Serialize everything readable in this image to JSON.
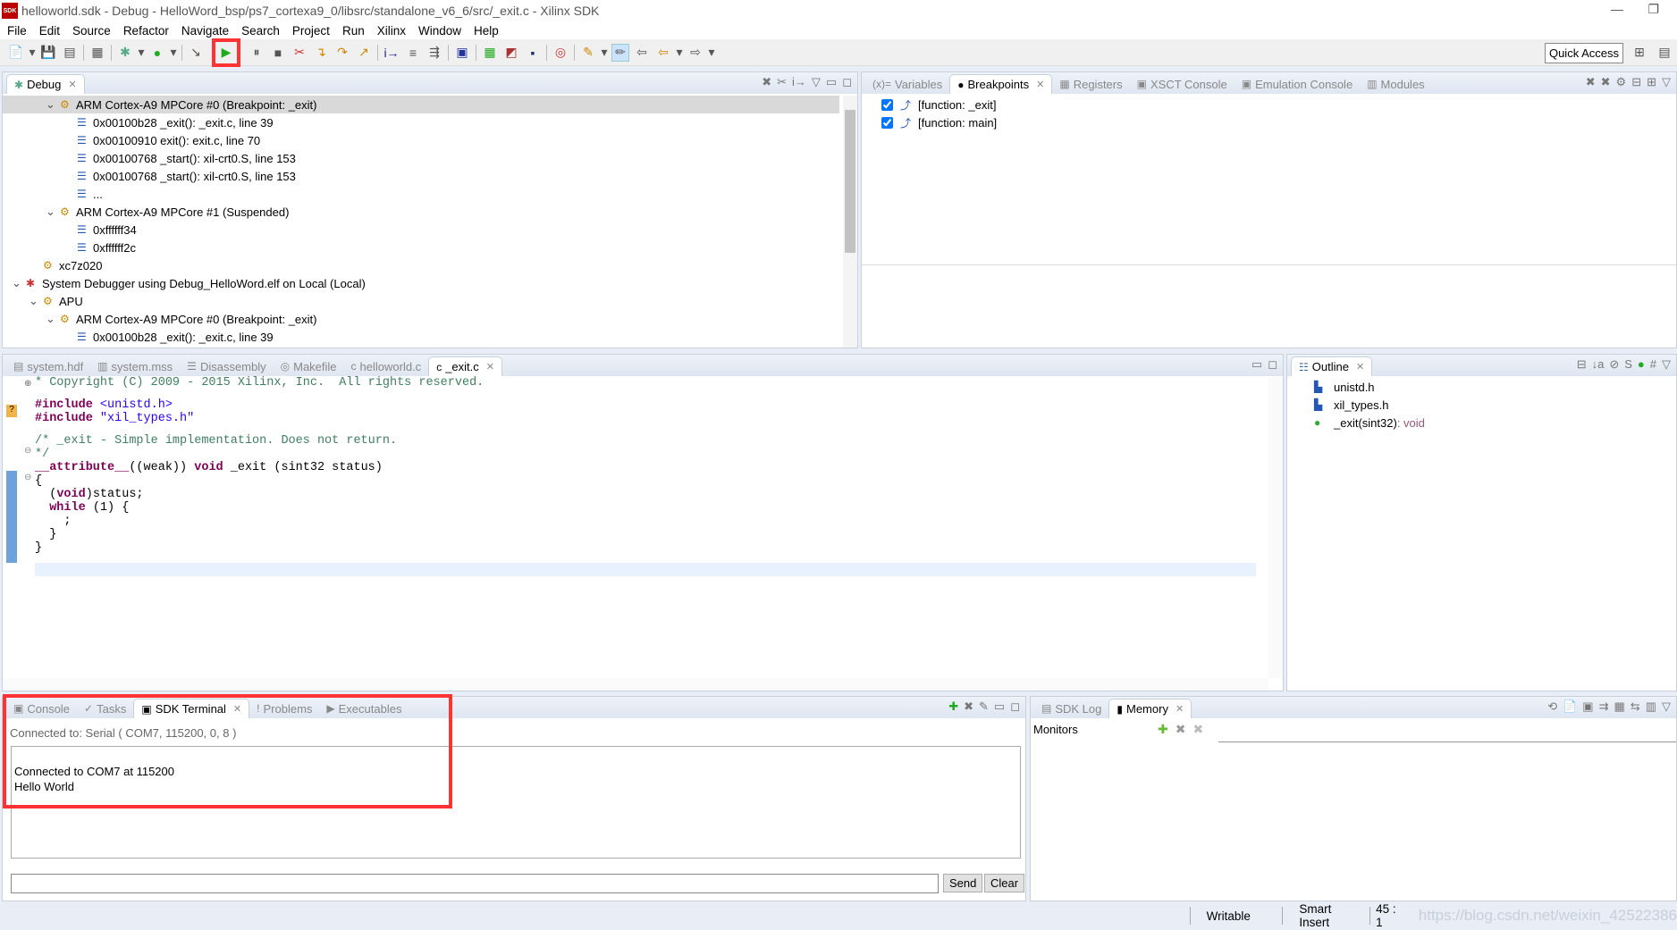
{
  "window": {
    "title": "helloworld.sdk - Debug - HelloWord_bsp/ps7_cortexa9_0/libsrc/standalone_v6_6/src/_exit.c - Xilinx SDK",
    "logo": "SDK"
  },
  "menu": [
    "File",
    "Edit",
    "Source",
    "Refactor",
    "Navigate",
    "Search",
    "Project",
    "Run",
    "Xilinx",
    "Window",
    "Help"
  ],
  "toolbar": {
    "quick_access": "Quick Access",
    "highlighted": "resume-button",
    "highlight_color": "#f33333"
  },
  "debug": {
    "tab": "Debug",
    "tree": [
      {
        "level": 2,
        "icon": "thread",
        "text": "ARM Cortex-A9 MPCore #0 (Breakpoint: _exit)",
        "expanded": true,
        "selected": true
      },
      {
        "level": 3,
        "icon": "frame",
        "text": "0x00100b28 _exit(): _exit.c, line 39"
      },
      {
        "level": 3,
        "icon": "frame",
        "text": "0x00100910 exit(): exit.c, line 70"
      },
      {
        "level": 3,
        "icon": "frame",
        "text": "0x00100768 _start(): xil-crt0.S, line 153"
      },
      {
        "level": 3,
        "icon": "frame",
        "text": "0x00100768 _start(): xil-crt0.S, line 153"
      },
      {
        "level": 3,
        "icon": "frame",
        "text": "..."
      },
      {
        "level": 2,
        "icon": "thread",
        "text": "ARM Cortex-A9 MPCore #1 (Suspended)",
        "expanded": true
      },
      {
        "level": 3,
        "icon": "frame",
        "text": "0xffffff34"
      },
      {
        "level": 3,
        "icon": "frame",
        "text": "0xffffff2c"
      },
      {
        "level": 1,
        "icon": "target",
        "text": "xc7z020"
      },
      {
        "level": 0,
        "icon": "debugger",
        "text": "System Debugger using Debug_HelloWord.elf on Local (Local)",
        "expanded": true
      },
      {
        "level": 1,
        "icon": "target",
        "text": "APU",
        "expanded": true
      },
      {
        "level": 2,
        "icon": "thread",
        "text": "ARM Cortex-A9 MPCore #0 (Breakpoint: _exit)",
        "expanded": true
      },
      {
        "level": 3,
        "icon": "frame",
        "text": "0x00100b28 _exit(): _exit.c, line 39"
      }
    ]
  },
  "right_top": {
    "tabs": [
      "Variables",
      "Breakpoints",
      "Registers",
      "XSCT Console",
      "Emulation Console",
      "Modules"
    ],
    "active": 1,
    "breakpoints": [
      {
        "checked": true,
        "text": "[function: _exit]"
      },
      {
        "checked": true,
        "text": "[function: main]"
      }
    ]
  },
  "editor": {
    "tabs": [
      "system.hdf",
      "system.mss",
      "Disassembly",
      "Makefile",
      "helloworld.c",
      "_exit.c"
    ],
    "active": 5,
    "lines": [
      "* Copyright (C) 2009 - 2015 Xilinx, Inc.  All rights reserved.",
      "",
      "#include <unistd.h>",
      "#include \"xil_types.h\"",
      "",
      "/* _exit - Simple implementation. Does not return.",
      "*/",
      "__attribute__((weak)) void _exit (sint32 status)",
      "{",
      "  (void)status;",
      "  while (1) {",
      "    ;",
      "  }",
      "}"
    ]
  },
  "outline": {
    "tab": "Outline",
    "items": [
      {
        "icon": "include",
        "text": "unistd.h"
      },
      {
        "icon": "include",
        "text": "xil_types.h"
      },
      {
        "icon": "function",
        "text": "_exit(sint32)",
        "type": " : void"
      }
    ]
  },
  "terminal": {
    "tabs": [
      "Console",
      "Tasks",
      "SDK Terminal",
      "Problems",
      "Executables"
    ],
    "active": 2,
    "connection": "Connected to: Serial (  COM7, 115200, 0, 8 )",
    "output": [
      "",
      "Connected to COM7 at 115200",
      "Hello World"
    ],
    "input_value": "",
    "send": "Send",
    "clear": "Clear"
  },
  "memory": {
    "tabs": [
      "SDK Log",
      "Memory"
    ],
    "active": 1,
    "monitors": "Monitors"
  },
  "status": {
    "writable": "Writable",
    "insert": "Smart Insert",
    "position": "45 : 1",
    "watermark": "https://blog.csdn.net/weixin_42522386"
  }
}
